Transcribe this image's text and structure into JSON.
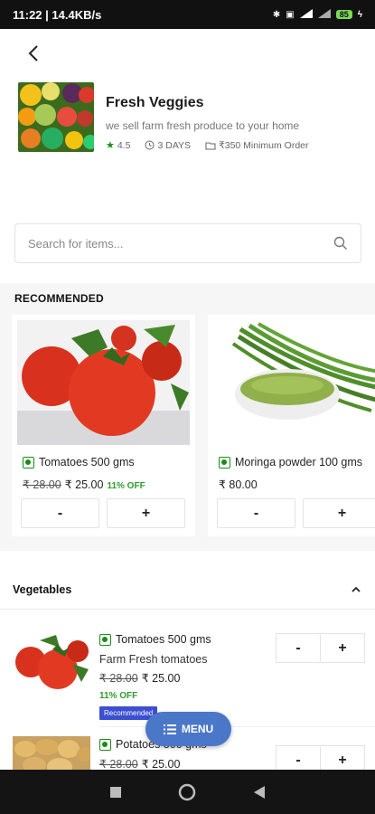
{
  "status_bar": {
    "time": "11:22 | 14.4KB/s",
    "battery": "85"
  },
  "store": {
    "name": "Fresh Veggies",
    "description": "we sell farm fresh produce to your home",
    "rating": "4.5",
    "delivery": "3 DAYS",
    "minimum_order": "₹350 Minimum Order"
  },
  "search": {
    "placeholder": "Search for items..."
  },
  "recommended": {
    "title": "RECOMMENDED",
    "items": [
      {
        "name": "Tomatoes 500 gms",
        "old_price": "₹ 28.00",
        "price": "₹ 25.00",
        "discount": "11% OFF",
        "minus": "-",
        "plus": "+"
      },
      {
        "name": "Moringa powder 100 gms",
        "old_price": "",
        "price": "₹ 80.00",
        "discount": "",
        "minus": "-",
        "plus": "+"
      }
    ]
  },
  "vegetables": {
    "title": "Vegetables",
    "items": [
      {
        "name": "Tomatoes 500 gms",
        "description": "Farm Fresh tomatoes",
        "old_price": "₹ 28.00",
        "price": "₹ 25.00",
        "discount": "11% OFF",
        "badge": "Recommended",
        "minus": "-",
        "plus": "+"
      },
      {
        "name": "Potatoes 500 gms",
        "old_price": "₹ 28.00",
        "price": "₹ 25.00",
        "minus": "-",
        "plus": "+"
      }
    ]
  },
  "menu_button": {
    "label": "MENU"
  },
  "colors": {
    "accent": "#4b77c9",
    "veg": "#1a8b1a",
    "discount": "#2e9b2e",
    "badge": "#3b4fd1"
  }
}
